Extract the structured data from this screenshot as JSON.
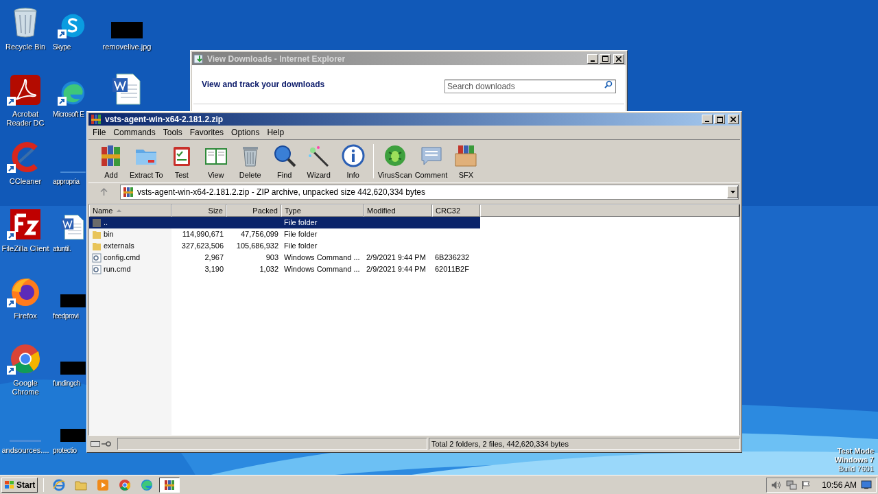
{
  "desktop_columns": [
    [
      {
        "label": "Recycle Bin",
        "kind": "recycle",
        "shortcut": false
      },
      {
        "label": "Acrobat Reader DC",
        "kind": "acrobat",
        "shortcut": true
      },
      {
        "label": "CCleaner",
        "kind": "ccleaner",
        "shortcut": true
      },
      {
        "label": "FileZilla Client",
        "kind": "filezilla",
        "shortcut": true
      },
      {
        "label": "Firefox",
        "kind": "firefox",
        "shortcut": true
      },
      {
        "label": "Google Chrome",
        "kind": "chrome",
        "shortcut": true
      },
      {
        "label": "andsources....",
        "kind": "blank",
        "shortcut": false
      }
    ],
    [
      {
        "label": "Skype",
        "kind": "skype",
        "shortcut": true
      },
      {
        "label": "Microsoft E",
        "kind": "edge",
        "shortcut": true
      },
      {
        "label": "appropria",
        "kind": "blank",
        "shortcut": false
      },
      {
        "label": "atuntil.",
        "kind": "word",
        "shortcut": false
      },
      {
        "label": "feedprovi",
        "kind": "redacted",
        "shortcut": false
      },
      {
        "label": "fundingch",
        "kind": "redacted",
        "shortcut": false
      },
      {
        "label": "protectio",
        "kind": "redacted",
        "shortcut": false
      }
    ],
    [
      {
        "label": "removelive.jpg",
        "kind": "redacted",
        "shortcut": false
      },
      {
        "kind": "word",
        "shortcut": false
      }
    ]
  ],
  "watermark_lines": [
    "Test Mode",
    "Windows 7",
    "Build 7601"
  ],
  "ie_window": {
    "title": "View Downloads - Internet Explorer",
    "heading": "View and track your downloads",
    "search": {
      "placeholder": "Search downloads"
    }
  },
  "winrar": {
    "title": "vsts-agent-win-x64-2.181.2.zip",
    "menu": [
      "File",
      "Commands",
      "Tools",
      "Favorites",
      "Options",
      "Help"
    ],
    "toolbar": [
      {
        "label": "Add",
        "kind": "add"
      },
      {
        "label": "Extract To",
        "kind": "extract"
      },
      {
        "label": "Test",
        "kind": "test"
      },
      {
        "label": "View",
        "kind": "view"
      },
      {
        "label": "Delete",
        "kind": "delete"
      },
      {
        "label": "Find",
        "kind": "find"
      },
      {
        "label": "Wizard",
        "kind": "wizard"
      },
      {
        "label": "Info",
        "kind": "info"
      },
      {
        "label": "VirusScan",
        "kind": "virus"
      },
      {
        "label": "Comment",
        "kind": "comment"
      },
      {
        "label": "SFX",
        "kind": "sfx"
      }
    ],
    "address": "vsts-agent-win-x64-2.181.2.zip - ZIP archive, unpacked size 442,620,334 bytes",
    "columns": [
      {
        "label": "Name",
        "sorted": true
      },
      {
        "label": "Size",
        "sorted": false
      },
      {
        "label": "Packed",
        "sorted": false
      },
      {
        "label": "Type",
        "sorted": false
      },
      {
        "label": "Modified",
        "sorted": false
      },
      {
        "label": "CRC32",
        "sorted": false
      }
    ],
    "rows": [
      {
        "kind": "up",
        "name": "..",
        "size": "",
        "packed": "",
        "type": "File folder",
        "modified": "",
        "crc": "",
        "selected": true
      },
      {
        "kind": "folder",
        "name": "bin",
        "size": "114,990,671",
        "packed": "47,756,099",
        "type": "File folder",
        "modified": "",
        "crc": "",
        "selected": false
      },
      {
        "kind": "folder",
        "name": "externals",
        "size": "327,623,506",
        "packed": "105,686,932",
        "type": "File folder",
        "modified": "",
        "crc": "",
        "selected": false
      },
      {
        "kind": "cmd",
        "name": "config.cmd",
        "size": "2,967",
        "packed": "903",
        "type": "Windows Command ...",
        "modified": "2/9/2021 9:44 PM",
        "crc": "6B236232",
        "selected": false
      },
      {
        "kind": "cmd",
        "name": "run.cmd",
        "size": "3,190",
        "packed": "1,032",
        "type": "Windows Command ...",
        "modified": "2/9/2021 9:44 PM",
        "crc": "62011B2F",
        "selected": false
      }
    ],
    "status": "Total 2 folders, 2 files, 442,620,334 bytes"
  },
  "taskbar": {
    "start": "Start",
    "apps": [
      {
        "kind": "ie",
        "active": false
      },
      {
        "kind": "folder",
        "active": false
      },
      {
        "kind": "media",
        "active": false
      },
      {
        "kind": "chrome",
        "active": false
      },
      {
        "kind": "edge",
        "active": false
      },
      {
        "kind": "winrar",
        "active": true
      }
    ],
    "clock": "10:56 AM"
  }
}
